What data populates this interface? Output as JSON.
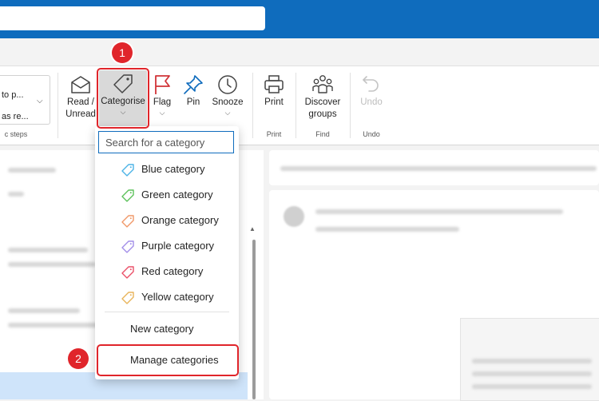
{
  "ribbon": {
    "quick_steps": {
      "items": [
        "to p...",
        "as re..."
      ],
      "group_label": "c steps"
    },
    "buttons": {
      "read_unread": {
        "line1": "Read /",
        "line2": "Unread",
        "icon": "envelope-open-icon"
      },
      "categorise": {
        "label": "Categorise",
        "icon": "tag-icon"
      },
      "flag": {
        "label": "Flag",
        "icon": "flag-icon"
      },
      "pin": {
        "label": "Pin",
        "icon": "pin-icon"
      },
      "snooze": {
        "label": "Snooze",
        "icon": "clock-icon"
      },
      "print": {
        "label": "Print",
        "icon": "printer-icon"
      },
      "discover_groups": {
        "line1": "Discover",
        "line2": "groups",
        "icon": "people-icon"
      },
      "undo": {
        "label": "Undo",
        "icon": "undo-icon"
      }
    },
    "group_labels": {
      "print": "Print",
      "find": "Find",
      "undo": "Undo"
    }
  },
  "category_menu": {
    "search_placeholder": "Search for a category",
    "categories": [
      {
        "label": "Blue category",
        "color": "#4cb3e6"
      },
      {
        "label": "Green category",
        "color": "#5cc15a"
      },
      {
        "label": "Orange category",
        "color": "#f09868"
      },
      {
        "label": "Purple category",
        "color": "#a28ee8"
      },
      {
        "label": "Red category",
        "color": "#ea5068"
      },
      {
        "label": "Yellow category",
        "color": "#e8b45a"
      }
    ],
    "new_category": "New category",
    "manage_categories": "Manage categories"
  },
  "annotations": {
    "step1": "1",
    "step2": "2",
    "highlight_color": "#e0252b"
  }
}
